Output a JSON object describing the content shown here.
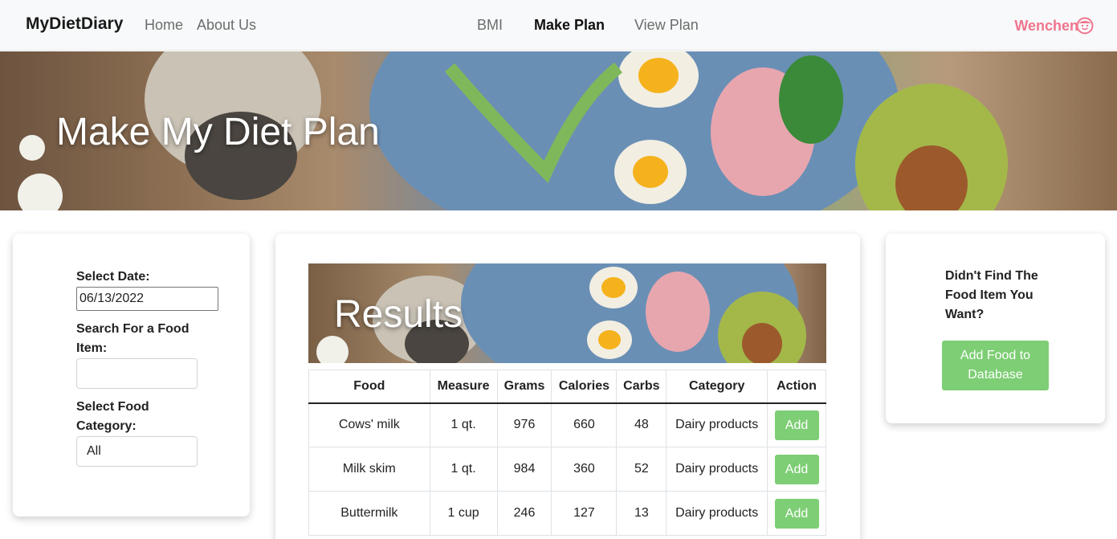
{
  "navbar": {
    "brand": "MyDietDiary",
    "links": [
      "Home",
      "About Us"
    ],
    "center_links": [
      "BMI",
      "Make Plan",
      "View Plan"
    ],
    "active": "Make Plan",
    "user": "Wenchen",
    "user_icon": "smiley-face-icon"
  },
  "hero": {
    "title": "Make My Diet Plan"
  },
  "left_panel": {
    "date_label": "Select Date:",
    "date_value": "06/13/2022",
    "search_label": "Search For a Food Item:",
    "search_value": "",
    "category_label": "Select Food Category:",
    "category_value": "All"
  },
  "results": {
    "title": "Results",
    "columns": [
      "Food",
      "Measure",
      "Grams",
      "Calories",
      "Carbs",
      "Category",
      "Action"
    ],
    "rows": [
      [
        "Cows' milk",
        "1 qt.",
        "976",
        "660",
        "48",
        "Dairy products",
        "Add"
      ],
      [
        "Milk skim",
        "1 qt.",
        "984",
        "360",
        "52",
        "Dairy products",
        "Add"
      ],
      [
        "Buttermilk",
        "1 cup",
        "246",
        "127",
        "13",
        "Dairy products",
        "Add"
      ]
    ]
  },
  "right_panel": {
    "prompt": "Didn't Find The Food Item You Want?",
    "button": "Add Food to Database"
  },
  "colors": {
    "accent_green": "#7dce74",
    "user_pink": "#f0758e"
  }
}
